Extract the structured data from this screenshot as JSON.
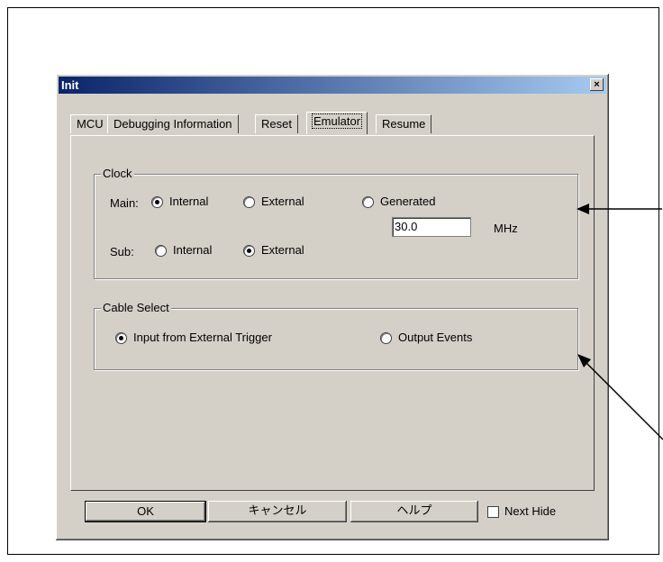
{
  "dialog": {
    "title": "Init",
    "close_glyph": "×"
  },
  "tabs": [
    {
      "label": "MCU"
    },
    {
      "label": "Debugging Information"
    },
    {
      "label": "Reset"
    },
    {
      "label": "Emulator",
      "selected": true
    },
    {
      "label": "Resume"
    }
  ],
  "clock": {
    "legend": "Clock",
    "main_label": "Main:",
    "main_options": [
      {
        "label": "Internal",
        "checked": true
      },
      {
        "label": "External",
        "checked": false
      },
      {
        "label": "Generated",
        "checked": false
      }
    ],
    "frequency_value": "30.0",
    "frequency_unit": "MHz",
    "sub_label": "Sub:",
    "sub_options": [
      {
        "label": "Internal",
        "checked": false
      },
      {
        "label": "External",
        "checked": true
      }
    ]
  },
  "cable": {
    "legend": "Cable Select",
    "options": [
      {
        "label": "Input from External Trigger",
        "checked": true
      },
      {
        "label": "Output Events",
        "checked": false
      }
    ]
  },
  "buttons": {
    "ok": "OK",
    "cancel": "キャンセル",
    "help": "ヘルプ",
    "next_hide": "Next Hide",
    "next_hide_checked": false
  },
  "colors": {
    "dialog_face": "#d4d0c8",
    "titlebar_start": "#0a246a",
    "titlebar_end": "#a6caf0"
  }
}
